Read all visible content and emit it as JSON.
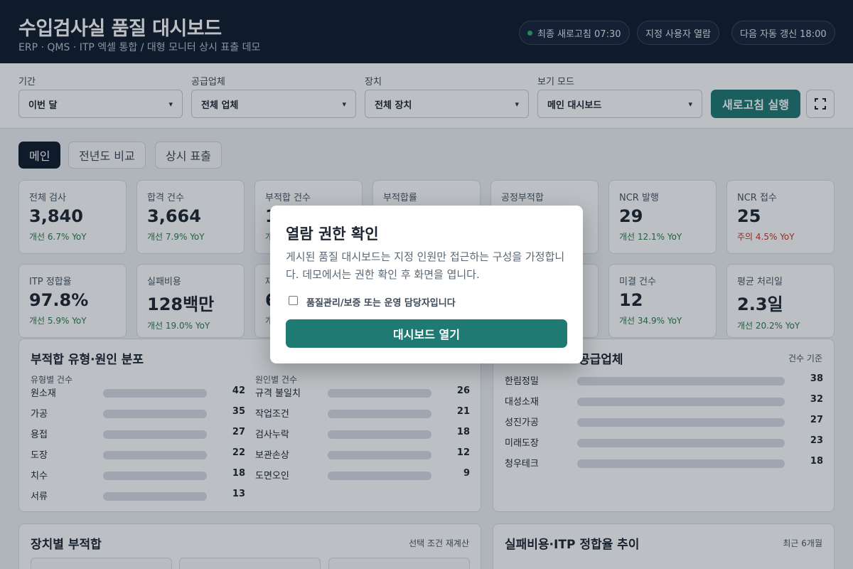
{
  "header": {
    "title": "수입검사실 품질 대시보드",
    "subtitle": "ERP · QMS · ITP 엑셀 통합 / 대형 모니터 상시 표출 데모",
    "status": "최종 새로고침 07:30",
    "viewer": "지정 사용자 열람",
    "next_refresh": "다음 자동 갱신 18:00"
  },
  "filters": {
    "period": {
      "label": "기간",
      "value": "이번 달"
    },
    "supplier": {
      "label": "공급업체",
      "value": "전체 업체"
    },
    "device": {
      "label": "장치",
      "value": "전체 장치"
    },
    "view_mode": {
      "label": "보기 모드",
      "value": "메인 대시보드"
    },
    "refresh_button": "새로고침 실행"
  },
  "tabs": [
    "메인",
    "전년도 비교",
    "상시 표출"
  ],
  "kpis_row1": [
    {
      "label": "전체 검사",
      "value": "3,840",
      "delta": "개선 6.7% YoY",
      "status": "good"
    },
    {
      "label": "합격 건수",
      "value": "3,664",
      "delta": "개선 7.9% YoY",
      "status": "good"
    },
    {
      "label": "부적합 건수",
      "value": "1",
      "delta": "개",
      "status": "good"
    },
    {
      "label": "부적합률",
      "value": "",
      "delta": "",
      "status": "good"
    },
    {
      "label": "공정부적합",
      "value": "",
      "delta": "",
      "status": "good"
    },
    {
      "label": "NCR 발행",
      "value": "29",
      "delta": "개선 12.1% YoY",
      "status": "good"
    },
    {
      "label": "NCR 접수",
      "value": "25",
      "delta": "주의 4.5% YoY",
      "status": "warn"
    }
  ],
  "kpis_row2": [
    {
      "label": "ITP 정합율",
      "value": "97.8%",
      "delta": "개선 5.9% YoY",
      "status": "good"
    },
    {
      "label": "실패비용",
      "value": "128백만",
      "delta": "개선 19.0% YoY",
      "status": "good"
    },
    {
      "label": "재",
      "value": "6",
      "delta": "개",
      "status": "good"
    },
    {
      "label": "",
      "value": "",
      "delta": "",
      "status": "good"
    },
    {
      "label": "",
      "value": "",
      "delta": "",
      "status": "good"
    },
    {
      "label": "미결 건수",
      "value": "12",
      "delta": "개선 34.9% YoY",
      "status": "good"
    },
    {
      "label": "평균 처리일",
      "value": "2.3일",
      "delta": "개선 20.2% YoY",
      "status": "good"
    }
  ],
  "defect_panel": {
    "title": "부적합 유형·원인 분포",
    "type_head": "유형별 건수",
    "cause_head": "원인별 건수",
    "types": [
      {
        "label": "원소재",
        "value": 42
      },
      {
        "label": "가공",
        "value": 35
      },
      {
        "label": "용접",
        "value": 27
      },
      {
        "label": "도장",
        "value": 22
      },
      {
        "label": "치수",
        "value": 18
      },
      {
        "label": "서류",
        "value": 13
      }
    ],
    "causes": [
      {
        "label": "규격 불일치",
        "value": 26
      },
      {
        "label": "작업조건",
        "value": 21
      },
      {
        "label": "검사누락",
        "value": 18
      },
      {
        "label": "보관손상",
        "value": 12
      },
      {
        "label": "도면오인",
        "value": 9
      }
    ]
  },
  "supplier_panel": {
    "title": "공급업체",
    "note": "건수 기준",
    "items": [
      {
        "label": "한림정밀",
        "value": 38
      },
      {
        "label": "대성소재",
        "value": 32
      },
      {
        "label": "성진가공",
        "value": 27
      },
      {
        "label": "미래도장",
        "value": 23
      },
      {
        "label": "청우테크",
        "value": 18
      }
    ]
  },
  "device_panel": {
    "title": "장치별 부적합",
    "note": "선택 조건 재계산"
  },
  "cost_panel": {
    "title": "실패비용·ITP 정합율 추이",
    "note": "최근 6개월"
  },
  "modal": {
    "title": "열람 권한 확인",
    "body": "게시된 품질 대시보드는 지정 인원만 접근하는 구성을 가정합니다. 데모에서는 권한 확인 후 화면을 엽니다.",
    "checkbox_label": "품질관리/보증 또는 운영 담당자입니다",
    "button": "대시보드 열기"
  }
}
